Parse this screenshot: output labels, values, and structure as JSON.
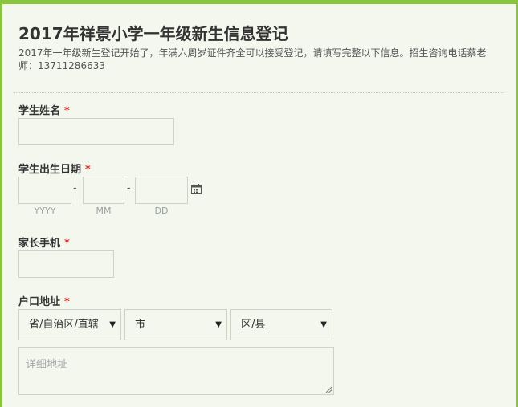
{
  "form": {
    "title": "2017年祥景小学一年级新生信息登记",
    "description": "2017年一年级新生登记开始了，年满六周岁证件齐全可以接受登记，请填写完整以下信息。招生咨询电话蔡老师：13711286633"
  },
  "fields": {
    "student_name": {
      "label": "学生姓名",
      "required": "*",
      "value": ""
    },
    "birth_date": {
      "label": "学生出生日期",
      "required": "*",
      "separator": "-",
      "year_hint": "YYYY",
      "month_hint": "MM",
      "day_hint": "DD",
      "calendar_icon": "calendar-icon"
    },
    "parent_phone": {
      "label": "家长手机",
      "required": "*",
      "value": ""
    },
    "address": {
      "label": "户口地址",
      "required": "*",
      "province": "省/自治区/直辖",
      "city": "市",
      "district": "区/县",
      "detail_placeholder": "详细地址",
      "dropdown_icon": "▼"
    }
  },
  "colors": {
    "accent_border": "#89c53b",
    "required": "#e02020",
    "background": "#f4f7ee"
  }
}
